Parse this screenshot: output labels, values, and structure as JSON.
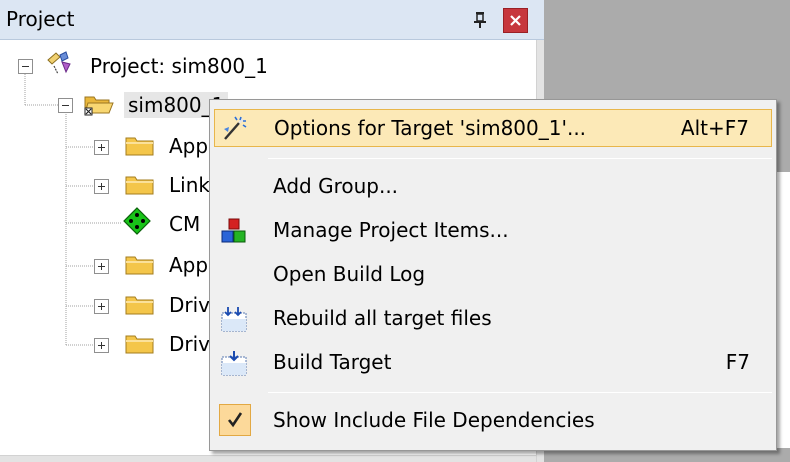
{
  "panel": {
    "title": "Project",
    "pin_icon": "pin-icon",
    "close_icon": "close-icon"
  },
  "tree": {
    "root": {
      "label": "Project: sim800_1",
      "icon": "project-icon"
    },
    "target": {
      "label": "sim800_1",
      "icon": "open-folder-icon"
    },
    "children": [
      {
        "label": "App",
        "icon": "folder-icon",
        "expandable": true
      },
      {
        "label": "Link",
        "icon": "folder-icon",
        "expandable": true
      },
      {
        "label": "CM",
        "icon": "cmsis-diamond-icon",
        "expandable": false
      },
      {
        "label": "App",
        "icon": "folder-icon",
        "expandable": true
      },
      {
        "label": "Driv",
        "icon": "folder-icon",
        "expandable": true
      },
      {
        "label": "Driv",
        "icon": "folder-icon",
        "expandable": true
      }
    ]
  },
  "context_menu": {
    "items": [
      {
        "label": "Options for Target 'sim800_1'...",
        "shortcut": "Alt+F7",
        "icon": "magic-wand-icon",
        "highlighted": true
      },
      {
        "label": "Add Group...",
        "shortcut": ""
      },
      {
        "label": "Manage Project Items...",
        "shortcut": "",
        "icon": "project-items-icon"
      },
      {
        "label": "Open Build Log",
        "shortcut": ""
      },
      {
        "label": "Rebuild all target files",
        "shortcut": "",
        "icon": "rebuild-icon"
      },
      {
        "label": "Build Target",
        "shortcut": "F7",
        "icon": "build-icon"
      },
      {
        "label": "Show Include File Dependencies",
        "shortcut": "",
        "icon": "checkmark-icon",
        "checked": true
      }
    ]
  },
  "colors": {
    "titlebar": "#dce6f3",
    "close_button": "#c7373d",
    "menu_background": "#f0f0f0",
    "highlight": "#fce9b7",
    "highlight_border": "#e8b64b",
    "folder": "#f4c64a"
  }
}
